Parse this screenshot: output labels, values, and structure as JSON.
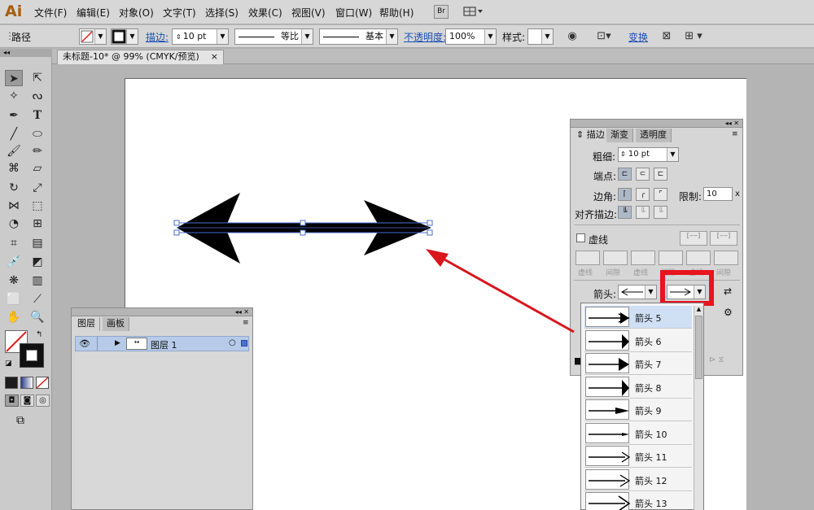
{
  "app": {
    "logo": "Ai"
  },
  "menubar": {
    "items": [
      "文件(F)",
      "编辑(E)",
      "对象(O)",
      "文字(T)",
      "选择(S)",
      "效果(C)",
      "视图(V)",
      "窗口(W)",
      "帮助(H)"
    ],
    "bridge_label": "Br"
  },
  "control_bar": {
    "selection_label": "路径",
    "stroke_link": "描边:",
    "stroke_weight": "10 pt",
    "profile_label": "等比",
    "brush_label": "基本",
    "opacity_link": "不透明度:",
    "opacity_value": "100%",
    "style_label": "样式:",
    "transform_link": "变换"
  },
  "document": {
    "tab_title": "未标题-10* @ 99% (CMYK/预览)",
    "close": "×"
  },
  "layers_panel": {
    "tabs": [
      "图层",
      "画板"
    ],
    "layer_name": "图层 1"
  },
  "stroke_panel": {
    "tabs": [
      "描边",
      "渐变",
      "透明度"
    ],
    "weight_label": "粗细:",
    "weight_value": "10 pt",
    "cap_label": "端点:",
    "corner_label": "边角:",
    "limit_label": "限制:",
    "limit_value": "10",
    "limit_unit": "x",
    "align_label": "对齐描边:",
    "dashed_label": "虚线",
    "dash_gap_labels": [
      "虚线",
      "间隙",
      "虚线",
      "间隙",
      "虚线",
      "间隙"
    ],
    "arrowheads_label": "箭头:"
  },
  "arrowhead_list": {
    "items": [
      "箭头 5",
      "箭头 6",
      "箭头 7",
      "箭头 8",
      "箭头 9",
      "箭头 10",
      "箭头 11",
      "箭头 12",
      "箭头 13"
    ],
    "selected_index": 0
  },
  "colors": {
    "highlight_red": "#e8141e",
    "annotation_arrow": "#d8161c",
    "selection_blue": "#4a6fd4"
  }
}
